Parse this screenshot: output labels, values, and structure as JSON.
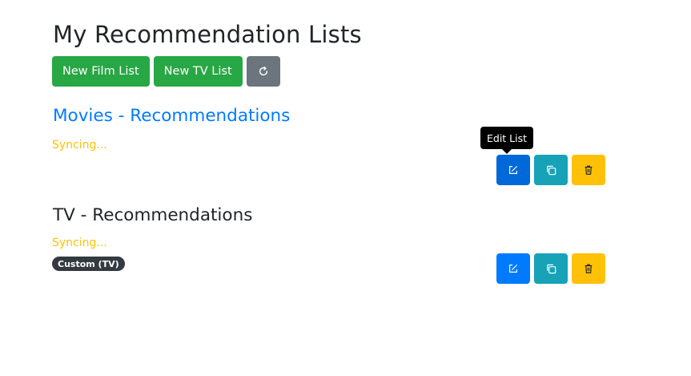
{
  "page": {
    "title": "My Recommendation Lists"
  },
  "toolbar": {
    "new_film_label": "New Film List",
    "new_tv_label": "New TV List",
    "refresh_icon": "refresh-icon"
  },
  "tooltip": {
    "text": "Edit List"
  },
  "lists": [
    {
      "title": "Movies - Recommendations",
      "status": "Syncing...",
      "badge": ""
    },
    {
      "title": "TV - Recommendations",
      "status": "Syncing...",
      "badge": "Custom (TV)"
    }
  ],
  "colors": {
    "primary": "#007bff",
    "success": "#28a745",
    "secondary": "#6c757d",
    "info": "#17a2b8",
    "warning": "#ffc107",
    "dark": "#343a40"
  },
  "icons": [
    "edit-icon",
    "copy-icon",
    "trash-icon",
    "refresh-icon"
  ]
}
